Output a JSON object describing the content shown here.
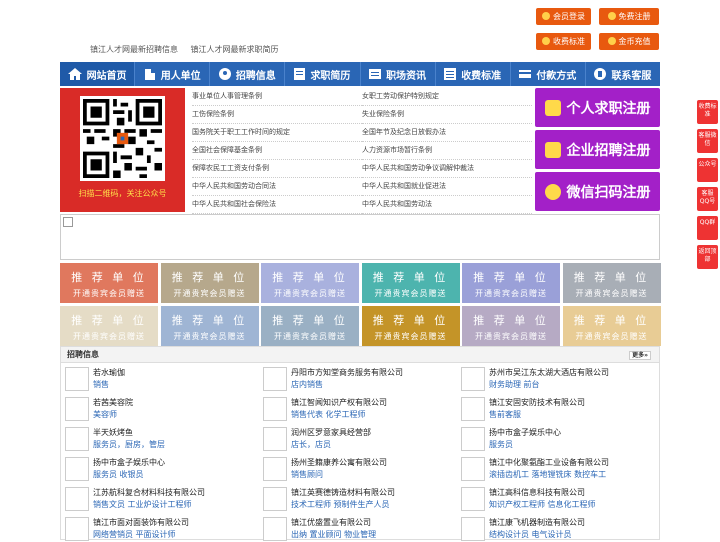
{
  "top_buttons": {
    "login": "会员登录",
    "register": "免费注册",
    "pricing": "收费标准",
    "recharge": "金币充值"
  },
  "top_links": [
    "镇江人才网最新招聘信息",
    "镇江人才网最新求职简历"
  ],
  "nav": [
    "网站首页",
    "用人单位",
    "招聘信息",
    "求职简历",
    "职场资讯",
    "收费标准",
    "付款方式",
    "联系客服"
  ],
  "qr_caption": "扫描二维码，关注公众号",
  "policies_left": [
    "事业单位人事管理条例",
    "工伤保险条例",
    "国务院关于职工工作时间的规定",
    "全国社会保障基金条例",
    "保障农民工工资支付条例",
    "中华人民共和国劳动合同法",
    "中华人民共和国社会保险法"
  ],
  "policies_right": [
    "女职工劳动保护特别规定",
    "失业保险条例",
    "全国年节及纪念日放假办法",
    "人力资源市场暂行条例",
    "中华人民共和国劳动争议调解仲裁法",
    "中华人民共和国就业促进法",
    "中华人民共和国劳动法"
  ],
  "register": {
    "personal": "个人求职注册",
    "company": "企业招聘注册",
    "wechat": "微信扫码注册"
  },
  "promo": {
    "title": "推 荐 单 位",
    "sub": "开通贵宾会员赠送"
  },
  "promo_colors": [
    "#e0785e",
    "#b6a88c",
    "#a9b1de",
    "#4db4ae",
    "#9aa0d8",
    "#a8aeb6",
    "#e5dcc6",
    "#9fb5d4",
    "#9ab0c4",
    "#c49428",
    "#b6aac4",
    "#e8cc95"
  ],
  "jobs": {
    "title": "招聘信息",
    "more": "更多»",
    "rows": [
      [
        {
          "co": "若水瑜伽",
          "pos": "销售"
        },
        {
          "co": "丹阳市方知堂商务服务有限公司",
          "pos": "店内销售"
        },
        {
          "co": "苏州市吴江东太湖大酒店有限公司",
          "pos": "财务助理 前台"
        }
      ],
      [
        {
          "co": "若茜美容院",
          "pos": "美容师"
        },
        {
          "co": "镇江智闻知识产权有限公司",
          "pos": "销售代表 化学工程师"
        },
        {
          "co": "镇江安固安防技术有限公司",
          "pos": "售前客服"
        }
      ],
      [
        {
          "co": "半天妖烤鱼",
          "pos": "服务员，厨房，管层"
        },
        {
          "co": "润州区罗意家具经营部",
          "pos": "店长，店员"
        },
        {
          "co": "扬中市盒子娱乐中心",
          "pos": "服务员"
        }
      ],
      [
        {
          "co": "扬中市盒子娱乐中心",
          "pos": "服务员 收银员"
        },
        {
          "co": "扬州圣籍康养公寓有限公司",
          "pos": "销售顾问"
        },
        {
          "co": "镇江中化聚氨酯工业设备有限公司",
          "pos": "滚插齿机工 落地镗铣床 数控车工"
        }
      ],
      [
        {
          "co": "江苏航科复合材料科技有限公司",
          "pos": "销售文员 工业炉设计工程师"
        },
        {
          "co": "镇江英赛德铸造材料有限公司",
          "pos": "技术工程师 预制件生产人员"
        },
        {
          "co": "镇江高科信息科技有限公司",
          "pos": "知识产权工程师 信息化工程师"
        }
      ],
      [
        {
          "co": "镇江市面对面装饰有限公司",
          "pos": "网络营销员 平面设计师"
        },
        {
          "co": "镇江优盛置业有限公司",
          "pos": "出纳 置业顾问 物业管理"
        },
        {
          "co": "镇江康飞机器制造有限公司",
          "pos": "结构设计员 电气设计员"
        }
      ]
    ]
  },
  "side": [
    "收费标准",
    "客服微信",
    "公众号",
    "客服QQ号",
    "QQ群",
    "返回顶部"
  ]
}
